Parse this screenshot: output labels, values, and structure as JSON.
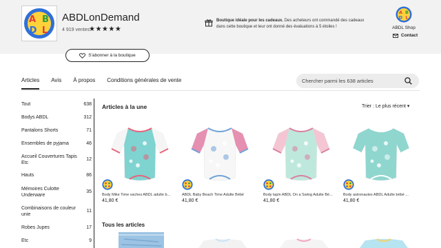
{
  "shop": {
    "name": "ABDLonDemand",
    "sales": "4 919 ventes",
    "stars": "★★★★★",
    "logo_letters": [
      "A",
      "B",
      "D",
      "L"
    ],
    "notice_bold": "Boutique idéale pour les cadeaux.",
    "notice_rest": " Des acheteurs ont commandé des cadeaux dans cette boutique et leur ont donné des évaluations à 5 étoiles !",
    "owner_name": "ABDL Shop",
    "contact_label": "Contact",
    "follow_label": "S'abonner à la boutique"
  },
  "tabs": [
    {
      "label": "Articles",
      "active": true
    },
    {
      "label": "Avis",
      "active": false
    },
    {
      "label": "À propos",
      "active": false
    },
    {
      "label": "Conditions générales de vente",
      "active": false
    }
  ],
  "search": {
    "placeholder": "Chercher parmi les 638 articles"
  },
  "sidebar": [
    {
      "label": "Tout",
      "count": "638"
    },
    {
      "label": "Bodys ABDL",
      "count": "312"
    },
    {
      "label": "Pantalons Shorts",
      "count": "71"
    },
    {
      "label": "Ensembles de pyjama",
      "count": "46"
    },
    {
      "label": "Accueil Couvertures Tapis Etc",
      "count": "12"
    },
    {
      "label": "Hauts",
      "count": "86"
    },
    {
      "label": "Mémoires Culotte Underware",
      "count": "35"
    },
    {
      "label": "Combinaisons de couleur unie",
      "count": "11"
    },
    {
      "label": "Robes Jupes",
      "count": "17"
    },
    {
      "label": "Etc",
      "count": "9"
    }
  ],
  "featured": {
    "title": "Articles à la une",
    "sort_label": "Trier : Le plus récent",
    "products": [
      {
        "title": "Body Mike Time vaches ABDL adulte b...",
        "price": "41,80 €",
        "colors": {
          "body": "#7fd3d0",
          "sleeve": "#f5f5f5",
          "accent": "#e8637b"
        }
      },
      {
        "title": "ABDL Baby Beach Time Adulte Bébé",
        "price": "41,80 €",
        "colors": {
          "body": "#f7f7f7",
          "sleeve": "#e58fb1",
          "accent": "#6fa3d8"
        }
      },
      {
        "title": "Body lapin ABDL On a Swing Adulte Bé...",
        "price": "41,80 €",
        "colors": {
          "body": "#bfe8dc",
          "sleeve": "#f4c6d3",
          "accent": "#d980a0"
        }
      },
      {
        "title": "Body astronautes ABDL Adulte bébé ...",
        "price": "41,80 €",
        "colors": {
          "body": "#8fd6cf",
          "sleeve": "#8fd6cf",
          "accent": "#ffffff"
        }
      }
    ]
  },
  "all_articles_title": "Tous les articles"
}
